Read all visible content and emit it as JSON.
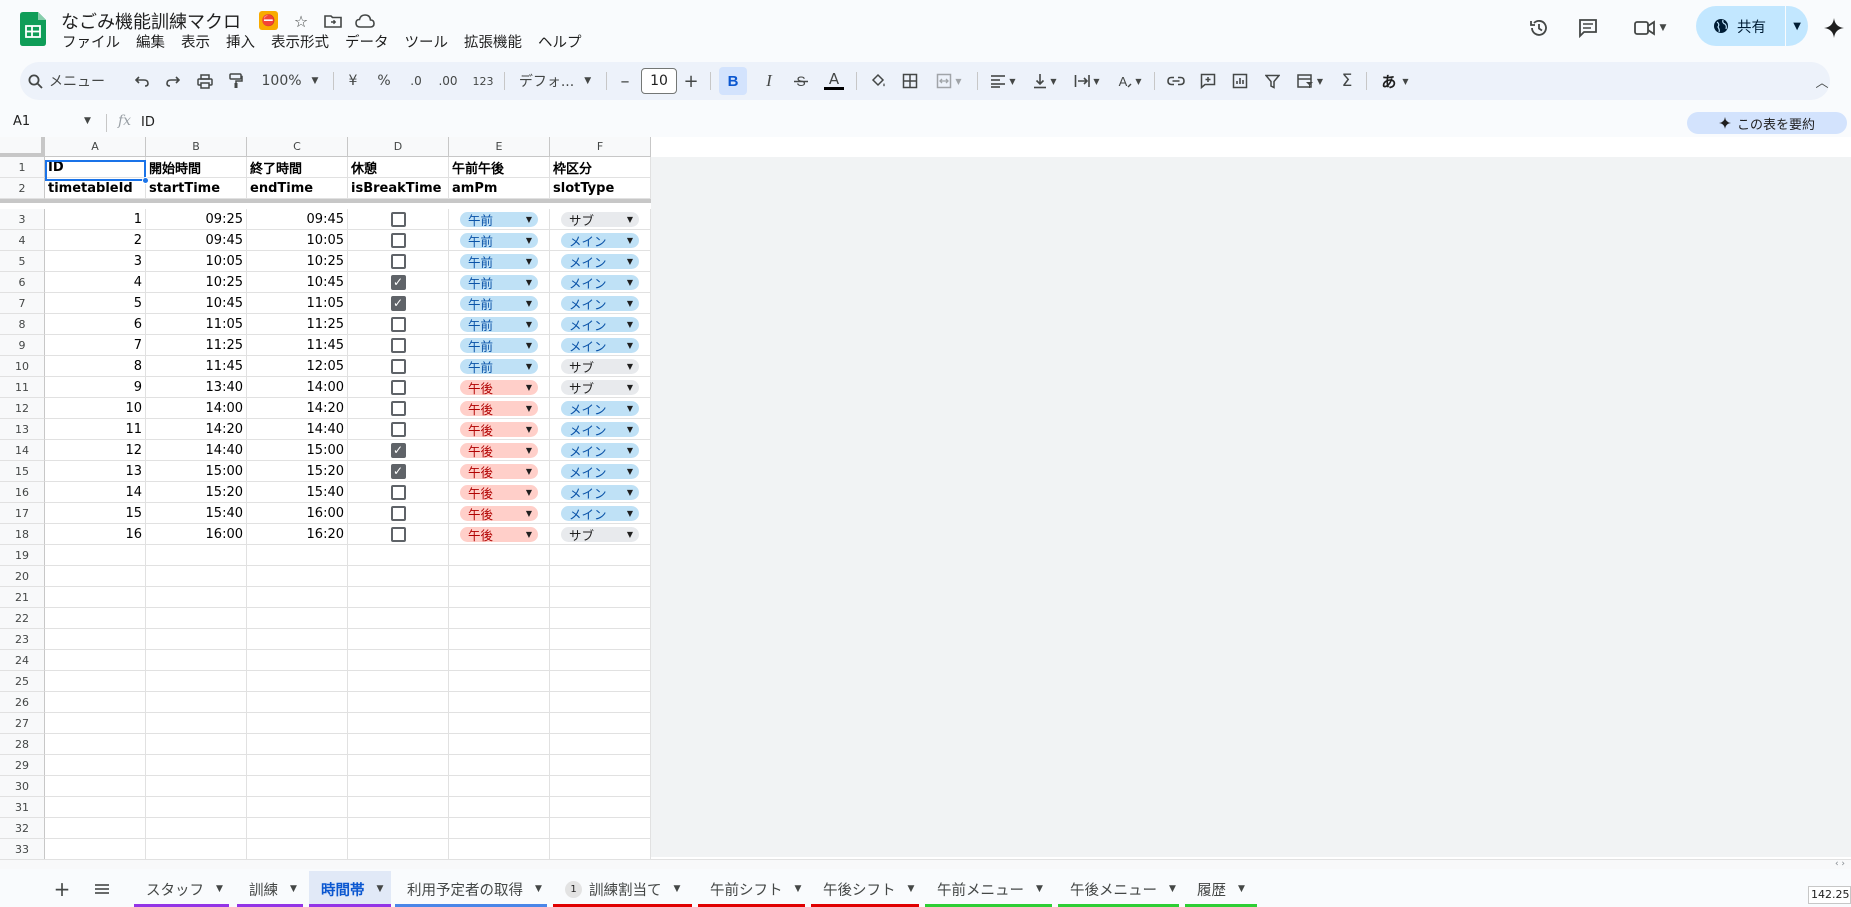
{
  "doc": {
    "title": "なごみ機能訓練マクロ"
  },
  "menu": [
    "ファイル",
    "編集",
    "表示",
    "挿入",
    "表示形式",
    "データ",
    "ツール",
    "拡張機能",
    "ヘルプ"
  ],
  "share": {
    "label": "共有"
  },
  "toolbar": {
    "search": "メニュー",
    "zoom": "100%",
    "currency": "¥",
    "percent": "%",
    "dec_minus": ".0",
    "dec_plus": ".00",
    "number_format": "123",
    "font": "デフォ...",
    "font_size": "10",
    "bold": "B",
    "italic": "I",
    "text_color": "A",
    "ime": "あ"
  },
  "formula": {
    "cell_ref": "A1",
    "fx": "fx",
    "value": "ID"
  },
  "summarize": {
    "label": "この表を要約"
  },
  "columns": [
    "A",
    "B",
    "C",
    "D",
    "E",
    "F"
  ],
  "header_row1": [
    "ID",
    "開始時間",
    "終了時間",
    "休憩",
    "午前午後",
    "枠区分"
  ],
  "header_row2": [
    "timetableId",
    "startTime",
    "endTime",
    "isBreakTime",
    "amPm",
    "slotType"
  ],
  "rows": [
    {
      "id": "1",
      "start": "09:25",
      "end": "09:45",
      "brk": false,
      "ampm": "午前",
      "slot": "サブ"
    },
    {
      "id": "2",
      "start": "09:45",
      "end": "10:05",
      "brk": false,
      "ampm": "午前",
      "slot": "メイン"
    },
    {
      "id": "3",
      "start": "10:05",
      "end": "10:25",
      "brk": false,
      "ampm": "午前",
      "slot": "メイン"
    },
    {
      "id": "4",
      "start": "10:25",
      "end": "10:45",
      "brk": true,
      "ampm": "午前",
      "slot": "メイン"
    },
    {
      "id": "5",
      "start": "10:45",
      "end": "11:05",
      "brk": true,
      "ampm": "午前",
      "slot": "メイン"
    },
    {
      "id": "6",
      "start": "11:05",
      "end": "11:25",
      "brk": false,
      "ampm": "午前",
      "slot": "メイン"
    },
    {
      "id": "7",
      "start": "11:25",
      "end": "11:45",
      "brk": false,
      "ampm": "午前",
      "slot": "メイン"
    },
    {
      "id": "8",
      "start": "11:45",
      "end": "12:05",
      "brk": false,
      "ampm": "午前",
      "slot": "サブ"
    },
    {
      "id": "9",
      "start": "13:40",
      "end": "14:00",
      "brk": false,
      "ampm": "午後",
      "slot": "サブ"
    },
    {
      "id": "10",
      "start": "14:00",
      "end": "14:20",
      "brk": false,
      "ampm": "午後",
      "slot": "メイン"
    },
    {
      "id": "11",
      "start": "14:20",
      "end": "14:40",
      "brk": false,
      "ampm": "午後",
      "slot": "メイン"
    },
    {
      "id": "12",
      "start": "14:40",
      "end": "15:00",
      "brk": true,
      "ampm": "午後",
      "slot": "メイン"
    },
    {
      "id": "13",
      "start": "15:00",
      "end": "15:20",
      "brk": true,
      "ampm": "午後",
      "slot": "メイン"
    },
    {
      "id": "14",
      "start": "15:20",
      "end": "15:40",
      "brk": false,
      "ampm": "午後",
      "slot": "メイン"
    },
    {
      "id": "15",
      "start": "15:40",
      "end": "16:00",
      "brk": false,
      "ampm": "午後",
      "slot": "メイン"
    },
    {
      "id": "16",
      "start": "16:00",
      "end": "16:20",
      "brk": false,
      "ampm": "午後",
      "slot": "サブ"
    }
  ],
  "visible_row_count": 33,
  "sheet_tabs": [
    {
      "label": "スタッフ",
      "color": "#9334e6",
      "active": false,
      "badge": ""
    },
    {
      "label": "訓練",
      "color": "#9334e6",
      "active": false,
      "badge": ""
    },
    {
      "label": "時間帯",
      "color": "#9334e6",
      "active": true,
      "badge": ""
    },
    {
      "label": "利用予定者の取得",
      "color": "#4a86e8",
      "active": false,
      "badge": ""
    },
    {
      "label": "訓練割当て",
      "color": "#e00000",
      "active": false,
      "badge": "1"
    },
    {
      "label": "午前シフト",
      "color": "#e00000",
      "active": false,
      "badge": ""
    },
    {
      "label": "午後シフト",
      "color": "#e00000",
      "active": false,
      "badge": ""
    },
    {
      "label": "午前メニュー",
      "color": "#2ece34",
      "active": false,
      "badge": ""
    },
    {
      "label": "午後メニュー",
      "color": "#2ece34",
      "active": false,
      "badge": ""
    },
    {
      "label": "履歴",
      "color": "#2ece34",
      "active": false,
      "badge": ""
    }
  ],
  "status": {
    "sum_value": "142.25"
  }
}
